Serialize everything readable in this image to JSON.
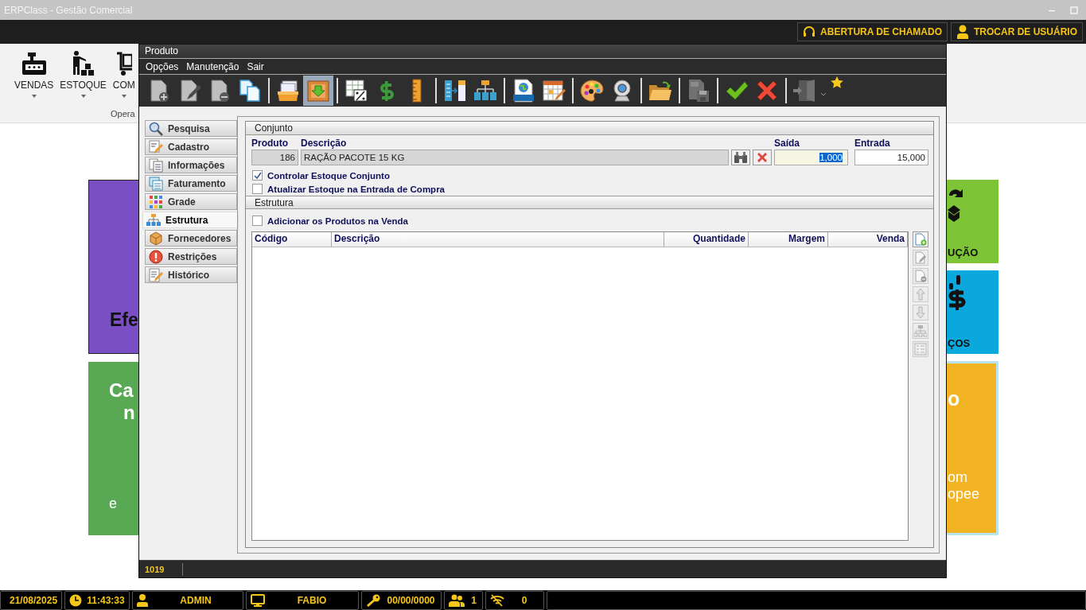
{
  "app": {
    "title": "ERPClass - Gestão Comercial"
  },
  "header_buttons": [
    {
      "label": "ABERTURA DE CHAMADO",
      "kind": "support"
    },
    {
      "label": "TROCAR DE USUÁRIO",
      "kind": "user"
    }
  ],
  "ribbon": {
    "items": [
      {
        "label": "VENDAS",
        "kind": "register"
      },
      {
        "label": "ESTOQUE",
        "kind": "stock"
      },
      {
        "label": "COM",
        "kind": "cart"
      }
    ],
    "group_label": "Opera"
  },
  "left_tiles": [
    {
      "color": "#7b4fc4",
      "lines": [
        "Efe"
      ]
    },
    {
      "color": "#58a854",
      "lines": [
        "Ca",
        "n",
        "e"
      ]
    }
  ],
  "right_tiles": [
    {
      "color": "#7dc436",
      "kind": "exchange",
      "lines": [
        "UÇÃO"
      ]
    },
    {
      "color": "#0aa8dc",
      "kind": "dollar",
      "lines": [
        "ÇOS"
      ]
    },
    {
      "color": "#f3b424",
      "kind": "text",
      "lines": [
        "o",
        "om",
        "opee"
      ]
    }
  ],
  "dialog": {
    "title": "Produto",
    "menu": [
      "Opções",
      "Manutenção",
      "Sair"
    ],
    "toolbar": [
      [
        {
          "kind": "new-document",
          "disabled": true,
          "selected": false
        },
        {
          "kind": "edit-document",
          "disabled": true,
          "selected": false
        },
        {
          "kind": "delete-document",
          "disabled": true,
          "selected": false
        },
        {
          "kind": "copy",
          "disabled": false,
          "selected": false
        }
      ],
      [
        {
          "kind": "card-tray",
          "disabled": false,
          "selected": false
        },
        {
          "kind": "box-down",
          "disabled": false,
          "selected": true
        }
      ],
      [
        {
          "kind": "table-percent",
          "disabled": false,
          "selected": false
        },
        {
          "kind": "dollar",
          "disabled": false,
          "selected": false
        },
        {
          "kind": "ruler",
          "disabled": false,
          "selected": false
        }
      ],
      [
        {
          "kind": "columns",
          "disabled": false,
          "selected": false
        },
        {
          "kind": "hierarchy",
          "disabled": false,
          "selected": false
        }
      ],
      [
        {
          "kind": "web-page",
          "disabled": false,
          "selected": false
        },
        {
          "kind": "calendar",
          "disabled": false,
          "selected": false
        }
      ],
      [
        {
          "kind": "palette",
          "disabled": false,
          "selected": false
        },
        {
          "kind": "webcam",
          "disabled": false,
          "selected": false
        }
      ],
      [
        {
          "kind": "folder",
          "disabled": false,
          "selected": false
        }
      ],
      [
        {
          "kind": "csv",
          "disabled": true,
          "selected": false
        }
      ],
      [
        {
          "kind": "check",
          "disabled": false,
          "selected": false
        },
        {
          "kind": "cancel",
          "disabled": false,
          "selected": false
        }
      ],
      [
        {
          "kind": "exit",
          "disabled": true,
          "selected": false
        },
        {
          "kind": "favorite",
          "disabled": false,
          "selected": false
        }
      ]
    ],
    "nav": [
      {
        "label": "Pesquisa",
        "kind": "search",
        "selected": false
      },
      {
        "label": "Cadastro",
        "kind": "form",
        "selected": false
      },
      {
        "label": "Informações",
        "kind": "info",
        "selected": false
      },
      {
        "label": "Faturamento",
        "kind": "billing",
        "selected": false
      },
      {
        "label": "Grade",
        "kind": "grid",
        "selected": false
      },
      {
        "label": "Estrutura",
        "kind": "structure",
        "selected": true
      },
      {
        "label": "Fornecedores",
        "kind": "supplier",
        "selected": false
      },
      {
        "label": "Restrições",
        "kind": "restriction",
        "selected": false
      },
      {
        "label": "Histórico",
        "kind": "history",
        "selected": false
      }
    ],
    "conjunto": {
      "title": "Conjunto",
      "fields": [
        {
          "label": "Produto",
          "value": "186",
          "kind": "number",
          "disabled": true,
          "focused": false
        },
        {
          "label": "Descrição",
          "value": "RAÇÃO PACOTE 15 KG",
          "kind": "text",
          "disabled": true,
          "focused": false
        },
        {
          "label": "Saída",
          "value": "1,000",
          "kind": "number",
          "disabled": false,
          "focused": true
        },
        {
          "label": "Entrada",
          "value": "15,000",
          "kind": "number",
          "disabled": false,
          "focused": false
        }
      ],
      "checks": [
        {
          "label": "Controlar Estoque Conjunto",
          "checked": true
        },
        {
          "label": "Atualizar Estoque na Entrada de Compra",
          "checked": false
        }
      ]
    },
    "estrutura": {
      "title": "Estrutura",
      "check": {
        "label": "Adicionar os Produtos na Venda",
        "checked": false
      },
      "columns": [
        {
          "label": "Código",
          "numeric": false
        },
        {
          "label": "Descrição",
          "numeric": false
        },
        {
          "label": "Quantidade",
          "numeric": true
        },
        {
          "label": "Margem",
          "numeric": true
        },
        {
          "label": "Venda",
          "numeric": true
        }
      ],
      "side_buttons": [
        {
          "kind": "add",
          "disabled": false
        },
        {
          "kind": "edit",
          "disabled": true
        },
        {
          "kind": "delete",
          "disabled": true
        },
        {
          "kind": "up",
          "disabled": true
        },
        {
          "kind": "down",
          "disabled": true
        },
        {
          "kind": "tree",
          "disabled": true
        },
        {
          "kind": "list",
          "disabled": true
        }
      ]
    },
    "status": "1019"
  },
  "status_bar": [
    {
      "kind": "date",
      "value": "21/08/2025"
    },
    {
      "kind": "time",
      "value": "11:43:33"
    },
    {
      "kind": "user",
      "value": "ADMIN"
    },
    {
      "kind": "computer",
      "value": "FABIO"
    },
    {
      "kind": "license",
      "value": "00/00/0000"
    },
    {
      "kind": "users",
      "value": "1"
    },
    {
      "kind": "network",
      "value": "0"
    }
  ]
}
